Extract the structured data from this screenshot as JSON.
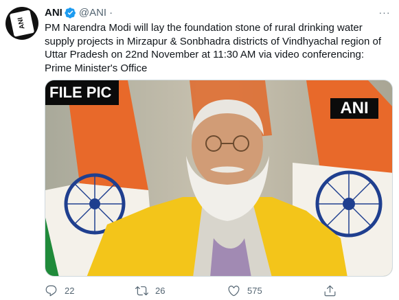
{
  "tweet": {
    "author_name": "ANI",
    "author_handle": "@ANI",
    "separator": "·",
    "more_label": "···",
    "avatar_text": "ANI",
    "text": "PM Narendra Modi will lay the foundation stone of rural drinking water supply projects in Mirzapur & Sonbhadra districts of Vindhyachal region of Uttar Pradesh on 22nd November at 11:30 AM via video conferencing: Prime Minister's Office",
    "media": {
      "overlay_left": "FILE PIC",
      "overlay_right": "ANI"
    },
    "actions": {
      "reply_count": "22",
      "retweet_count": "26",
      "like_count": "575"
    }
  },
  "colors": {
    "verified": "#1d9bf0",
    "secondary_text": "#536471",
    "saffron": "#e8692a",
    "green": "#1f8a3a",
    "kurta": "#f3c51a"
  },
  "icons": [
    "verified-badge-icon",
    "more-icon",
    "reply-icon",
    "retweet-icon",
    "like-icon",
    "share-icon"
  ]
}
